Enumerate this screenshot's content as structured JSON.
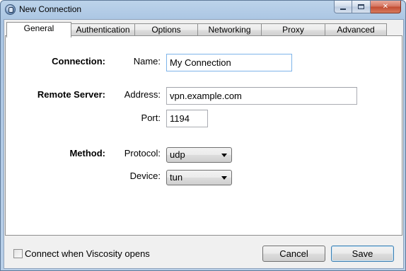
{
  "window": {
    "title": "New Connection",
    "icon": "viscosity-app-icon"
  },
  "tabs": [
    {
      "label": "General",
      "active": true
    },
    {
      "label": "Authentication",
      "active": false
    },
    {
      "label": "Options",
      "active": false
    },
    {
      "label": "Networking",
      "active": false
    },
    {
      "label": "Proxy",
      "active": false
    },
    {
      "label": "Advanced",
      "active": false
    }
  ],
  "general": {
    "connection": {
      "section_label": "Connection:",
      "name_label": "Name:",
      "name_value": "My Connection"
    },
    "remote_server": {
      "section_label": "Remote Server:",
      "address_label": "Address:",
      "address_value": "vpn.example.com",
      "port_label": "Port:",
      "port_value": "1194"
    },
    "method": {
      "section_label": "Method:",
      "protocol_label": "Protocol:",
      "protocol_value": "udp",
      "device_label": "Device:",
      "device_value": "tun"
    }
  },
  "footer": {
    "checkbox_label": "Connect when Viscosity opens",
    "checkbox_checked": false,
    "cancel_label": "Cancel",
    "save_label": "Save"
  },
  "colors": {
    "title_bar": "#b8cfe8",
    "close_button": "#c24a30",
    "panel": "#ffffff",
    "dialog": "#f0f0f0",
    "focus_border": "#7eb4ea"
  }
}
